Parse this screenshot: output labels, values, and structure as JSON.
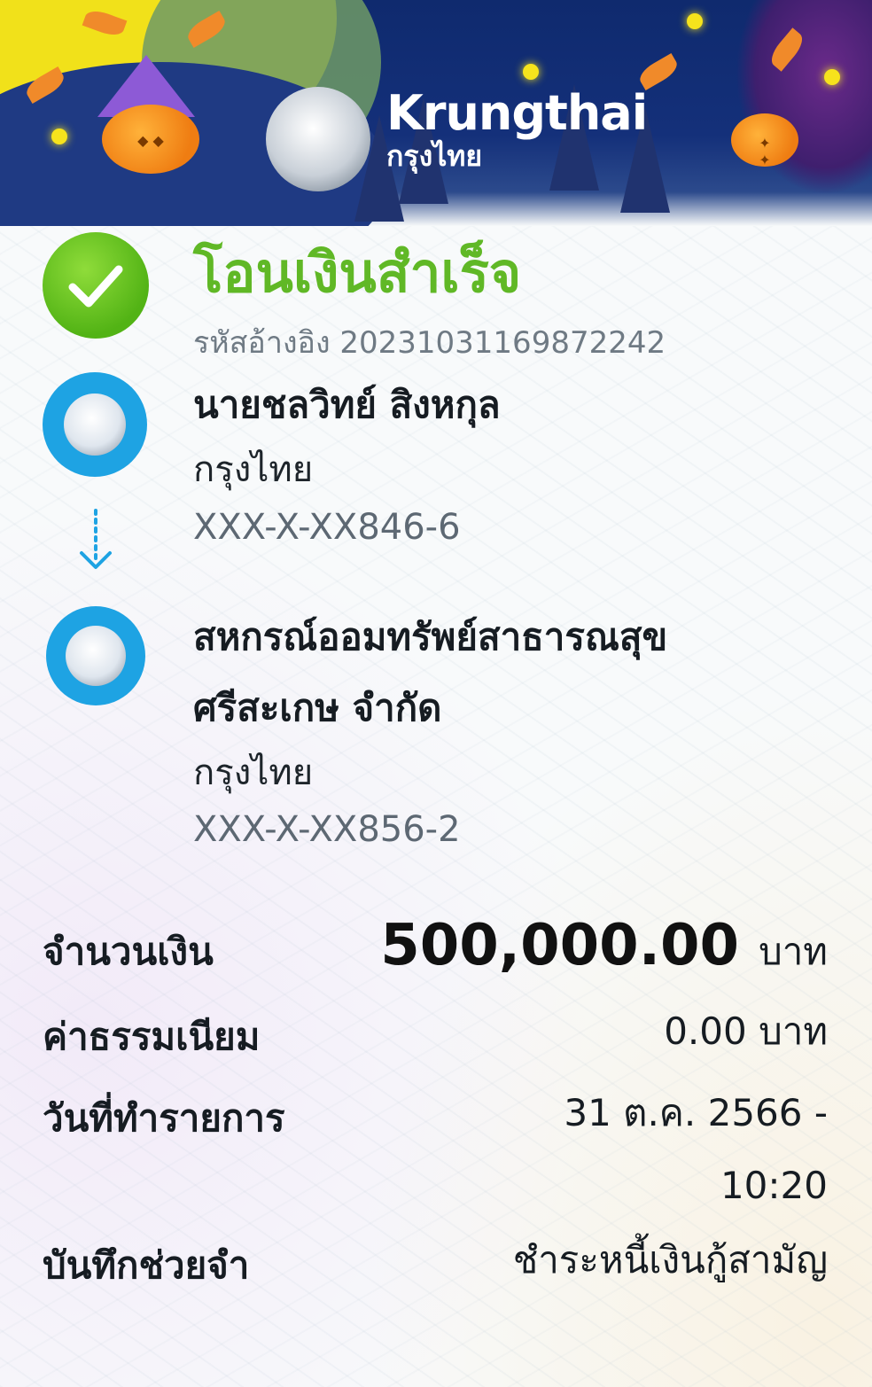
{
  "brand": {
    "name_en": "Krungthai",
    "name_th": "กรุงไทย"
  },
  "status": {
    "title": "โอนเงินสำเร็จ",
    "ref_label": "รหัสอ้างอิง",
    "ref_no": "2023103116987224​2"
  },
  "sender": {
    "name": "นายชลวิทย์ สิงหกุล",
    "bank": "กรุงไทย",
    "account": "XXX-X-XX846-6"
  },
  "receiver": {
    "name_line1": "สหกรณ์ออมทรัพย์สาธารณสุข",
    "name_line2": "ศรีสะเกษ จำกัด",
    "bank": "กรุงไทย",
    "account": "XXX-X-XX856-2"
  },
  "details": {
    "amount_label": "จำนวนเงิน",
    "amount": "500,000.00",
    "amount_unit": "บาท",
    "fee_label": "ค่าธรรมเนียม",
    "fee": "0.00 บาท",
    "date_label": "วันที่ทำรายการ",
    "date_line1": "31 ต.ค. 2566 -",
    "date_line2": "10:20",
    "memo_label": "บันทึกช่วยจำ",
    "memo": "ชำระหนี้เงินกู้สามัญ"
  },
  "colors": {
    "success": "#60b826",
    "bank_blue": "#1ea3e3",
    "header_navy": "#14307a"
  },
  "icons": {
    "status": "check-icon",
    "bank": "krungthai-bird-icon",
    "flow": "arrow-down-icon"
  }
}
